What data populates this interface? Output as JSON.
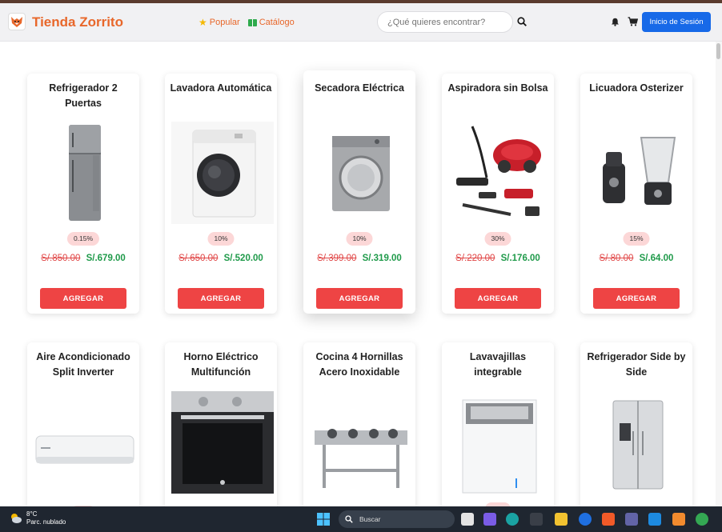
{
  "header": {
    "brand": "Tienda Zorrito",
    "nav": [
      {
        "label": "Popular",
        "icon": "star-icon"
      },
      {
        "label": "Catálogo",
        "icon": "book-icon"
      }
    ],
    "search_placeholder": "¿Qué quieres encontrar?",
    "login_label": "Inicio de Sesión"
  },
  "products_row1": [
    {
      "title": "Refrigerador 2 Puertas",
      "discount": "0.15%",
      "old_price": "S/.850.00",
      "new_price": "S/.679.00",
      "button": "AGREGAR",
      "image": "fridge-image"
    },
    {
      "title": "Lavadora Automática",
      "discount": "10%",
      "old_price": "S/.650.00",
      "new_price": "S/.520.00",
      "button": "AGREGAR",
      "image": "washer-image"
    },
    {
      "title": "Secadora Eléctrica",
      "discount": "10%",
      "old_price": "S/.399.00",
      "new_price": "S/.319.00",
      "button": "AGREGAR",
      "image": "dryer-image"
    },
    {
      "title": "Aspiradora sin Bolsa",
      "discount": "30%",
      "old_price": "S/.220.00",
      "new_price": "S/.176.00",
      "button": "AGREGAR",
      "image": "vacuum-image"
    },
    {
      "title": "Licuadora Osterizer",
      "discount": "15%",
      "old_price": "S/.80.00",
      "new_price": "S/.64.00",
      "button": "AGREGAR",
      "image": "blender-image"
    }
  ],
  "products_row2": [
    {
      "title": "Aire Acondicionado Split Inverter",
      "image": "air-conditioner-image"
    },
    {
      "title": "Horno Eléctrico Multifunción",
      "image": "oven-image"
    },
    {
      "title": "Cocina 4 Hornillas Acero Inoxidable",
      "image": "stove-image"
    },
    {
      "title": "Lavavajillas integrable",
      "image": "dishwasher-image"
    },
    {
      "title": "Refrigerador Side by Side",
      "image": "side-by-side-fridge-image"
    }
  ],
  "taskbar": {
    "temperature": "8°C",
    "weather": "Parc. nublado",
    "search_label": "Buscar"
  },
  "colors": {
    "brand": "#e8672a",
    "primary": "#1769e8",
    "danger": "#ee4444",
    "price_new": "#1f9a4a",
    "badge_bg": "#fcd7d7"
  }
}
